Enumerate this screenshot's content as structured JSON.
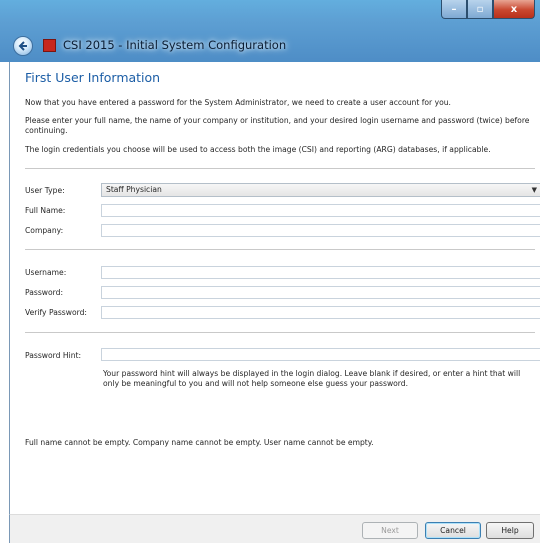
{
  "window": {
    "title": "CSI 2015 - Initial System Configuration",
    "controls": {
      "minimize": "–",
      "maximize": "▫",
      "close": "x"
    }
  },
  "page": {
    "heading": "First User Information",
    "intro": "Now that you have entered a password for the System Administrator, we need to create a user account for you.",
    "instructions": "Please enter your full name, the name of your company or institution, and your desired login username and password (twice) before continuing.",
    "credentials_note": "The login credentials you choose will be used to access both the image (CSI) and reporting (ARG) databases, if applicable."
  },
  "form": {
    "user_type": {
      "label": "User Type:",
      "value": "Staff Physician"
    },
    "full_name": {
      "label": "Full Name:",
      "value": ""
    },
    "company": {
      "label": "Company:",
      "value": ""
    },
    "username": {
      "label": "Username:",
      "value": ""
    },
    "password": {
      "label": "Password:",
      "value": ""
    },
    "verify_password": {
      "label": "Verify Password:",
      "value": ""
    },
    "password_hint": {
      "label": "Password Hint:",
      "value": "",
      "help": "Your password hint will always be displayed in the login dialog. Leave blank if desired, or enter a hint that will only be meaningful to you and will not help someone else guess your password."
    }
  },
  "validation": {
    "message": "Full name cannot be empty. Company name cannot be empty. User name cannot be empty."
  },
  "footer": {
    "next_label": "Next",
    "cancel_label": "Cancel",
    "help_label": "Help"
  },
  "colors": {
    "titlebar": "#5d9fd3",
    "heading": "#1c5ea6",
    "close_button": "#c9472f",
    "app_icon": "#c7261d"
  }
}
